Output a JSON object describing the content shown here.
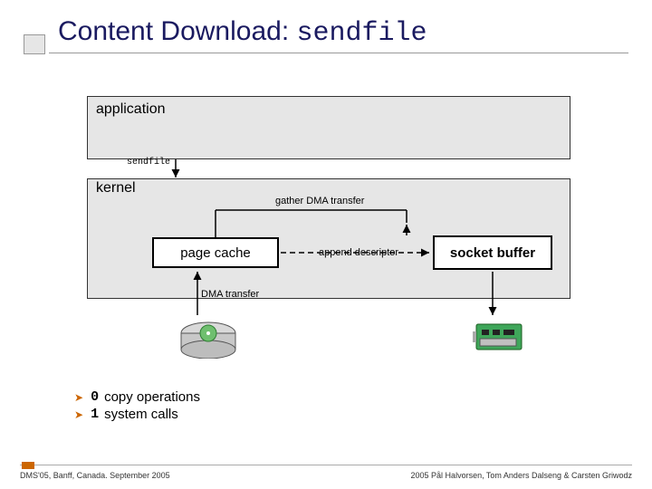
{
  "title": {
    "prefix": "Content Download: ",
    "mono": "sendfile"
  },
  "layers": {
    "app": "application",
    "kernel": "kernel",
    "syscall": "sendfile"
  },
  "boxes": {
    "page_cache": "page cache",
    "socket_buffer": "socket buffer"
  },
  "arrows": {
    "gather": "gather DMA transfer",
    "append": "append descriptor",
    "dma": "DMA transfer"
  },
  "bullets": [
    {
      "count": "0",
      "text": "copy operations"
    },
    {
      "count": "1",
      "text": "system calls"
    }
  ],
  "footer": {
    "left": "DMS'05, Banff, Canada. September 2005",
    "right": "2005  Pål Halvorsen, Tom Anders Dalseng & Carsten Griwodz"
  },
  "icons": {
    "disk": "hard-disk-icon",
    "nic": "network-card-icon"
  }
}
